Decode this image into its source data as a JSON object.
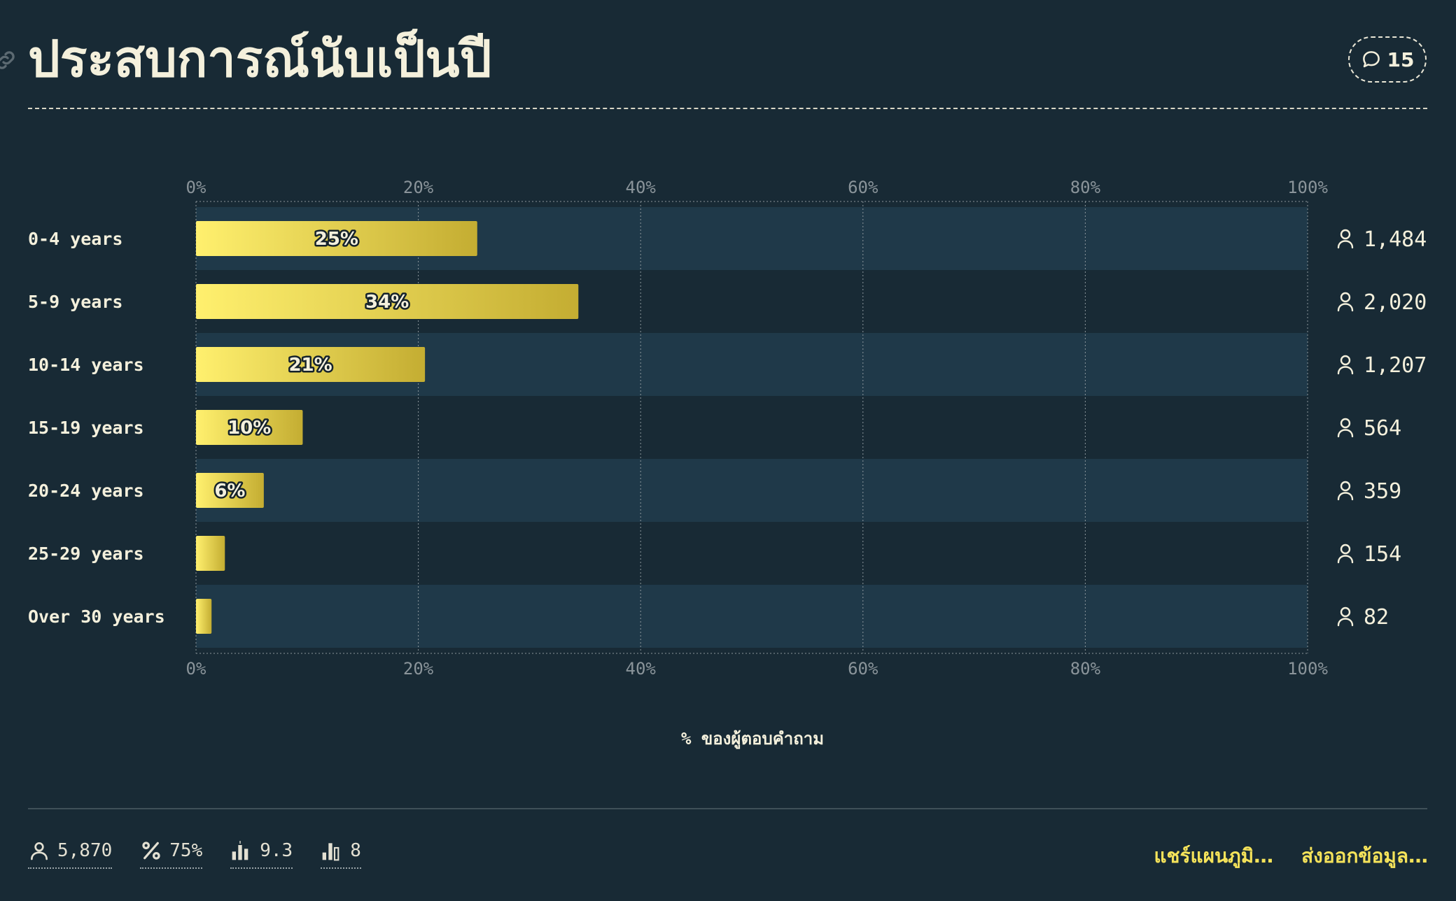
{
  "title": "ประสบการณ์นับเป็นปี",
  "comment_count": "15",
  "chart_data": {
    "type": "bar",
    "orientation": "horizontal",
    "categories": [
      "0-4 years",
      "5-9 years",
      "10-14 years",
      "15-19 years",
      "20-24 years",
      "25-29 years",
      "Over 30 years"
    ],
    "values": [
      25.3,
      34.4,
      20.6,
      9.6,
      6.1,
      2.6,
      1.4
    ],
    "value_labels": [
      "25%",
      "34%",
      "21%",
      "10%",
      "6%",
      "",
      ""
    ],
    "counts": [
      "1,484",
      "2,020",
      "1,207",
      "564",
      "359",
      "154",
      "82"
    ],
    "xlim": [
      0,
      100
    ],
    "xticks": [
      "0%",
      "20%",
      "40%",
      "60%",
      "80%",
      "100%"
    ],
    "xlabel": "% ของผู้ตอบคำถาม",
    "grid": true,
    "colors": {
      "bar_start": "#fff06e",
      "bar_end": "#c4ad32",
      "row_band": "#1f3949",
      "background": "#182a35",
      "accent": "#f5e35a"
    }
  },
  "footer": {
    "respondents": "5,870",
    "percent": "75%",
    "average": "9.3",
    "median": "8",
    "share_label": "แชร์แผนภูมิ…",
    "export_label": "ส่งออกข้อมูล…"
  }
}
